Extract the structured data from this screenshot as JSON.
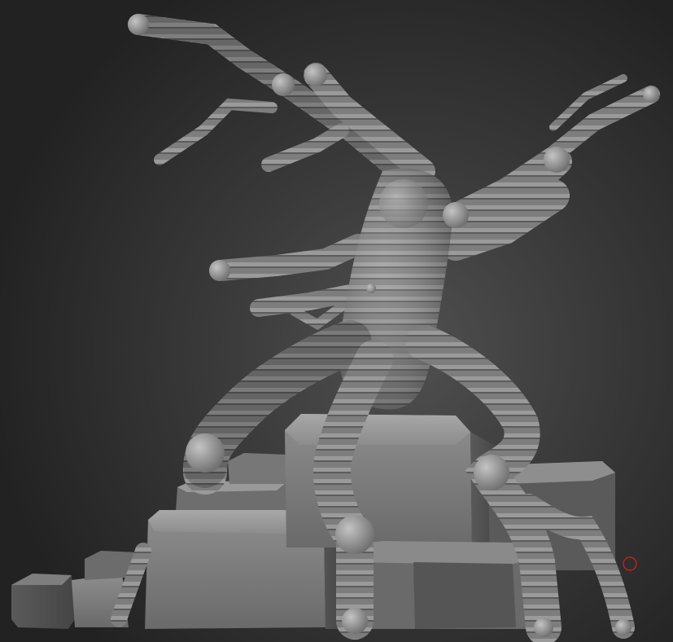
{
  "scene": {
    "subject": "sculpted-tree-model",
    "background_color": "#2a2a2a",
    "material_color": "#8a8a8a",
    "cursor_color": "#c02020"
  }
}
